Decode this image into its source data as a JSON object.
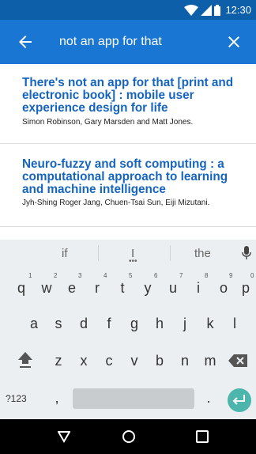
{
  "status": {
    "time": "12:30"
  },
  "search": {
    "query": "not an app for that"
  },
  "results": [
    {
      "title": "There's not an app for that [print and electronic book] : mobile user experience design for life",
      "authors": "Simon Robinson, Gary Marsden and Matt Jones."
    },
    {
      "title": "Neuro-fuzzy and soft computing : a computational approach to learning and machine intelligence",
      "authors": "Jyh-Shing Roger Jang, Chuen-Tsai Sun, Eiji Mizutani."
    }
  ],
  "keyboard": {
    "suggestions": [
      "if",
      "I",
      "the"
    ],
    "row1": [
      "q",
      "w",
      "e",
      "r",
      "t",
      "y",
      "u",
      "i",
      "o",
      "p"
    ],
    "row1_hints": [
      "1",
      "2",
      "3",
      "4",
      "5",
      "6",
      "7",
      "8",
      "9",
      "0"
    ],
    "row2": [
      "a",
      "s",
      "d",
      "f",
      "g",
      "h",
      "j",
      "k",
      "l"
    ],
    "row3": [
      "z",
      "x",
      "c",
      "v",
      "b",
      "n",
      "m"
    ],
    "row4": {
      "symbols": "?123",
      "comma": ",",
      "period": "."
    }
  },
  "colors": {
    "statusbar": "#0d5fa9",
    "appbar": "#1976d2",
    "title": "#1565c0",
    "enter_button": "#4db6ac"
  },
  "icons": {
    "back": "arrow-left-icon",
    "close": "close-icon",
    "mic": "mic-icon",
    "shift": "shift-icon",
    "backspace": "backspace-icon",
    "enter": "enter-icon"
  }
}
